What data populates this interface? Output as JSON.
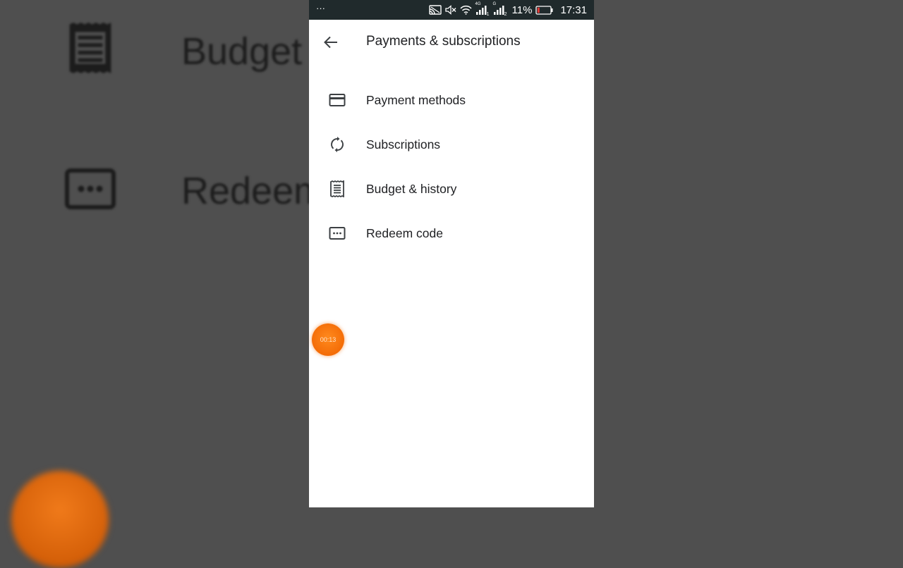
{
  "background": {
    "items": [
      {
        "label": "Budget",
        "icon": "receipt-icon"
      },
      {
        "label": "Redeem",
        "icon": "redeem-icon"
      }
    ]
  },
  "status_bar": {
    "dots": "···",
    "battery_percent": "11%",
    "time": "17:31",
    "signal_1_label": "4G",
    "signal_2_label": "G",
    "signal_sub": "1",
    "signal_sub_2": "2"
  },
  "app_bar": {
    "title": "Payments & subscriptions",
    "back_icon": "arrow-back-icon"
  },
  "menu": {
    "items": [
      {
        "label": "Payment methods",
        "icon": "credit-card-icon"
      },
      {
        "label": "Subscriptions",
        "icon": "sync-icon"
      },
      {
        "label": "Budget & history",
        "icon": "receipt-icon"
      },
      {
        "label": "Redeem code",
        "icon": "redeem-icon"
      }
    ]
  },
  "recording": {
    "timer": "00:13"
  },
  "colors": {
    "status_bar_bg": "#202a2c",
    "recording_orange": "#f36a05",
    "background_dim": "#4f4f4f"
  }
}
